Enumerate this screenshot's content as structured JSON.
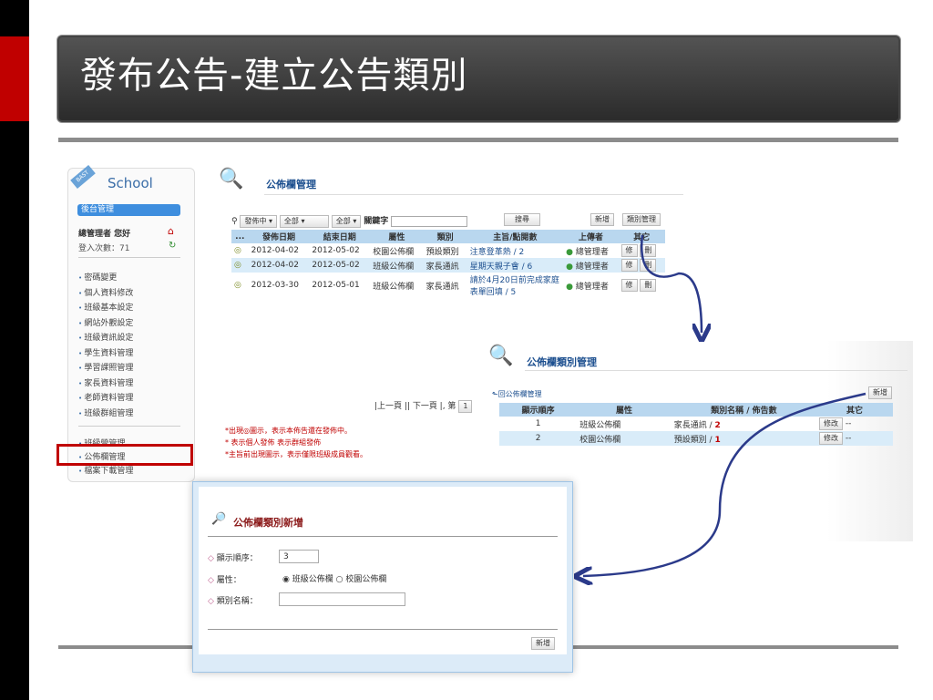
{
  "title": "發布公告-建立公告類別",
  "sidebar": {
    "logo": "School",
    "badge": "BAST",
    "backend": "後台管理",
    "user": "總管理者 您好",
    "logins": "登入次數：71",
    "items": [
      "密碼變更",
      "個人資料修改",
      "班級基本設定",
      "網站外觀設定",
      "班級資訊設定",
      "學生資料管理",
      "學習課照管理",
      "家長資料管理",
      "老師資料管理",
      "班級群組管理"
    ],
    "items2": [
      "班級營管理",
      "公佈欄管理",
      "檔案下載管理"
    ]
  },
  "board": {
    "title": "公佈欄管理",
    "filter": {
      "status": "發佈中",
      "cat": "全部",
      "attr": "全部",
      "keyword_label": "關鍵字",
      "search": "搜尋",
      "add": "新增",
      "catmgr": "類別管理"
    },
    "headers": [
      "...",
      "發佈日期",
      "結束日期",
      "屬性",
      "類別",
      "主旨/點閱數",
      "上傳者",
      "其它"
    ],
    "rows": [
      [
        "2012-04-02",
        "2012-05-02",
        "校園公佈欄",
        "預設類別",
        "注意登革熱 / 2",
        "總管理者"
      ],
      [
        "2012-04-02",
        "2012-05-02",
        "班級公佈欄",
        "家長通訊",
        "星期天親子會 / 6",
        "總管理者"
      ],
      [
        "2012-03-30",
        "2012-05-01",
        "班級公佈欄",
        "家長通訊",
        "請於4月20日前完成家庭表單回填 / 5",
        "總管理者"
      ]
    ],
    "edit": "修",
    "del": "刪",
    "pager": "|上一頁 || 下一頁 |, 第",
    "page": "1",
    "notes": [
      "*出現◎圖示，表示本佈告還在發佈中。",
      "* 表示個人發佈 表示群組發佈",
      "*主旨前出現圖示，表示僅限班級成員觀看。"
    ]
  },
  "catmgr": {
    "title": "公佈欄類別管理",
    "back": "回公佈欄管理",
    "add": "新增",
    "headers": [
      "顯示順序",
      "屬性",
      "類別名稱 / 佈告數",
      "其它"
    ],
    "rows": [
      [
        "1",
        "班級公佈欄",
        "家長通訊 / ",
        "2",
        "修改",
        "--"
      ],
      [
        "2",
        "校園公佈欄",
        "預設類別 / ",
        "1",
        "修改",
        "--"
      ]
    ]
  },
  "form": {
    "title": "公佈欄類別新增",
    "order_label": "顯示順序：",
    "order_value": "3",
    "attr_label": "屬性：",
    "opt1": "班級公佈欄",
    "opt2": "校園公佈欄",
    "name_label": "類別名稱：",
    "submit": "新增"
  },
  "colors": {
    "accent": "#c00000",
    "header": "#b9d7ef",
    "arrow": "#2b3a8a"
  }
}
